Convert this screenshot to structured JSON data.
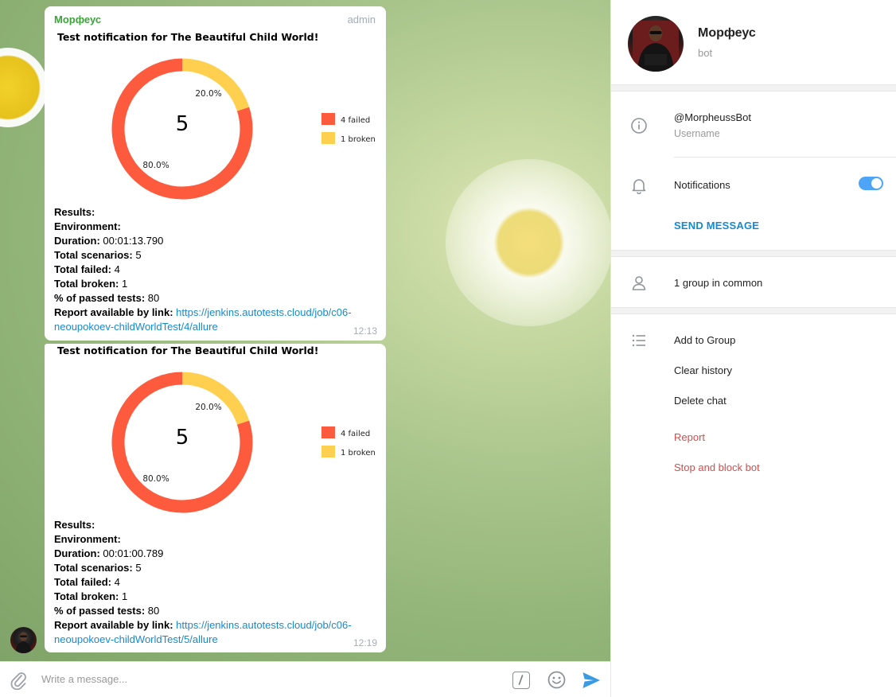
{
  "chat": {
    "messages": [
      {
        "sender": "Морфеус",
        "role": "admin",
        "chart": {
          "title": "Test notification for The Beautiful Child World!",
          "center_value": "5",
          "failed_pct_label": "80.0%",
          "broken_pct_label": "20.0%",
          "legend_failed": "4 failed",
          "legend_broken": "1 broken"
        },
        "results_label": "Results:",
        "environment_label": "Environment:",
        "duration_label": "Duration:",
        "duration_value": "00:01:13.790",
        "total_scenarios_label": "Total scenarios:",
        "total_scenarios_value": "5",
        "total_failed_label": "Total failed:",
        "total_failed_value": "4",
        "total_broken_label": "Total broken:",
        "total_broken_value": "1",
        "passed_label": "% of passed tests:",
        "passed_value": "80",
        "report_label": "Report available by link:",
        "report_link_line1": "https://jenkins.autotests.cloud/job/c06-",
        "report_link_line2": "neoupokoev-childWorldTest/4/allure",
        "time": "12:13"
      },
      {
        "chart": {
          "title": "Test notification for The Beautiful Child World!",
          "center_value": "5",
          "failed_pct_label": "80.0%",
          "broken_pct_label": "20.0%",
          "legend_failed": "4 failed",
          "legend_broken": "1 broken"
        },
        "results_label": "Results:",
        "environment_label": "Environment:",
        "duration_label": "Duration:",
        "duration_value": "00:01:00.789",
        "total_scenarios_label": "Total scenarios:",
        "total_scenarios_value": "5",
        "total_failed_label": "Total failed:",
        "total_failed_value": "4",
        "total_broken_label": "Total broken:",
        "total_broken_value": "1",
        "passed_label": "% of passed tests:",
        "passed_value": "80",
        "report_label": "Report available by link:",
        "report_link_line1": "https://jenkins.autotests.cloud/job/c06-",
        "report_link_line2": "neoupokoev-childWorldTest/5/allure",
        "time": "12:19"
      }
    ]
  },
  "chart_data": [
    {
      "type": "pie",
      "title": "Test notification for The Beautiful Child World!",
      "categories": [
        "failed",
        "broken"
      ],
      "values": [
        4,
        1
      ],
      "percent_labels": [
        "80.0%",
        "20.0%"
      ],
      "legend": [
        "4 failed",
        "1 broken"
      ],
      "legend_position": "right",
      "colors": [
        "#fd5a3e",
        "#ffd050"
      ]
    },
    {
      "type": "pie",
      "title": "Test notification for The Beautiful Child World!",
      "categories": [
        "failed",
        "broken"
      ],
      "values": [
        4,
        1
      ],
      "percent_labels": [
        "80.0%",
        "20.0%"
      ],
      "legend": [
        "4 failed",
        "1 broken"
      ],
      "legend_position": "right",
      "colors": [
        "#fd5a3e",
        "#ffd050"
      ]
    }
  ],
  "composer": {
    "placeholder": "Write a message...",
    "attach_icon": "paperclip-icon",
    "command_icon": "slash-command-icon",
    "emoji_icon": "smile-icon",
    "send_icon": "send-arrow-icon"
  },
  "panel": {
    "name": "Морфеус",
    "subtitle": "bot",
    "username": "@MorpheussBot",
    "username_label": "Username",
    "notifications_label": "Notifications",
    "notifications_on": true,
    "send_message": "SEND MESSAGE",
    "groups_in_common": "1 group in common",
    "actions": [
      "Add to Group",
      "Clear history",
      "Delete chat"
    ],
    "danger_actions": [
      "Report",
      "Stop and block bot"
    ],
    "accent_color": "#168acd",
    "danger_color": "#d14e4e"
  }
}
